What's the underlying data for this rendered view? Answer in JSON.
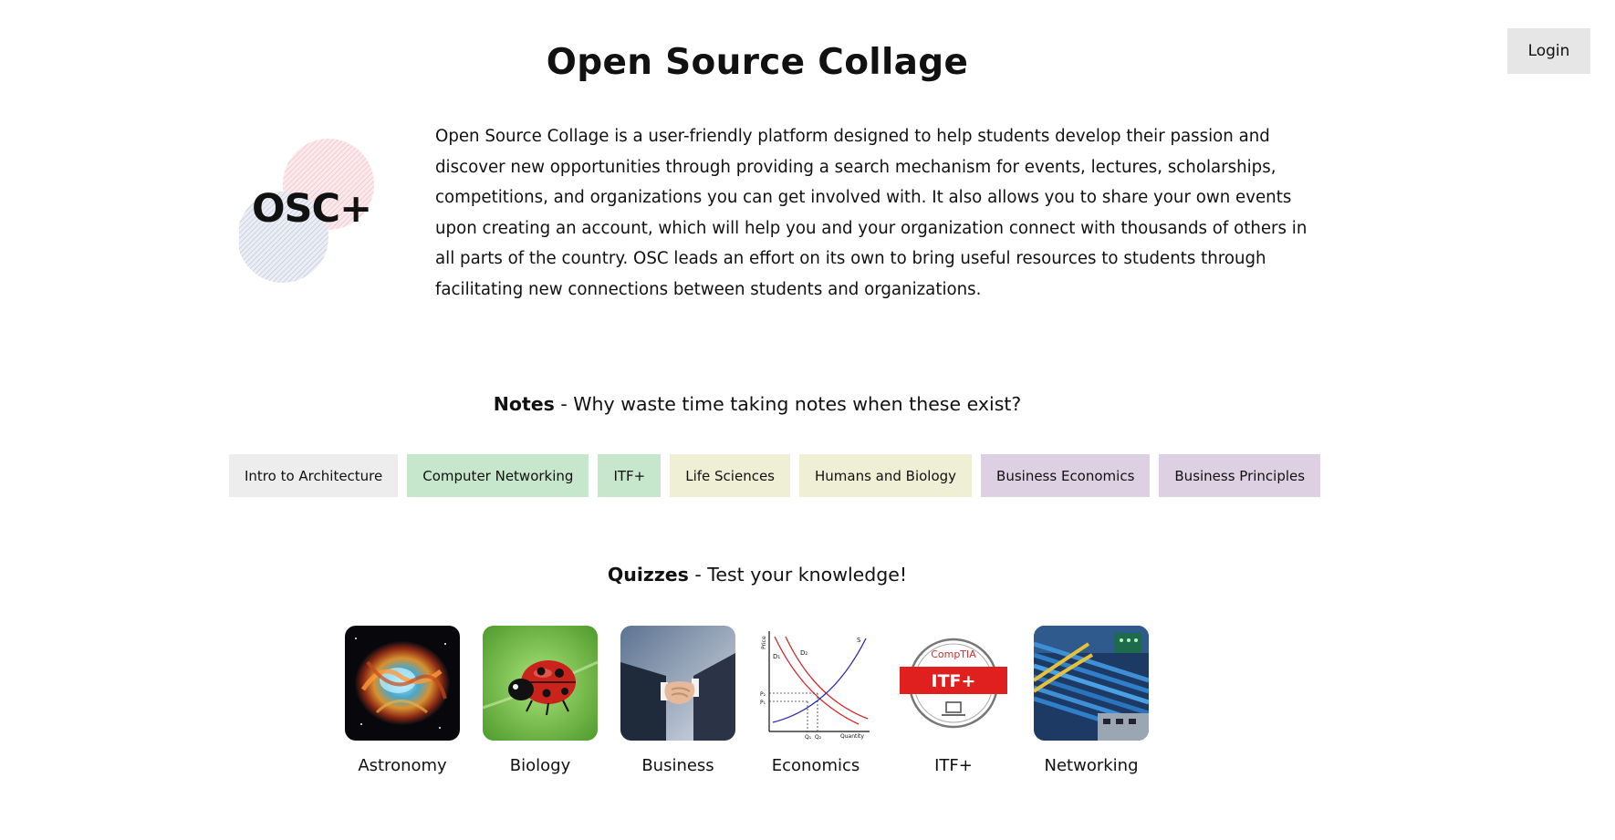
{
  "header": {
    "login_label": "Login",
    "title": "Open Source Collage"
  },
  "logo": {
    "text": "OSC+"
  },
  "intro": {
    "text": "Open Source Collage is a user-friendly platform designed to help students develop their passion and discover new opportunities through providing a search mechanism for events, lectures, scholarships, competitions, and organizations you can get involved with. It also allows you to share your own events upon creating an account, which will help you and your organization connect with thousands of others in all parts of the country. OSC leads an effort on its own to bring useful resources to students through facilitating new connections between students and organizations."
  },
  "notes": {
    "heading_bold": "Notes",
    "heading_rest": " - Why waste time taking notes when these exist?",
    "items": [
      {
        "label": "Intro to Architecture",
        "color": "#ededed"
      },
      {
        "label": "Computer Networking",
        "color": "#c6e7cb"
      },
      {
        "label": "ITF+",
        "color": "#c6e7cb"
      },
      {
        "label": "Life Sciences",
        "color": "#efefd6"
      },
      {
        "label": "Humans and Biology",
        "color": "#efefd6"
      },
      {
        "label": "Business Economics",
        "color": "#ddd0e3"
      },
      {
        "label": "Business Principles",
        "color": "#ddd0e3"
      }
    ]
  },
  "quizzes": {
    "heading_bold": "Quizzes",
    "heading_rest": " - Test your knowledge!",
    "items": [
      {
        "label": "Astronomy",
        "icon": "nebula-image"
      },
      {
        "label": "Biology",
        "icon": "ladybug-image"
      },
      {
        "label": "Business",
        "icon": "handshake-image"
      },
      {
        "label": "Economics",
        "icon": "supply-demand-chart-image"
      },
      {
        "label": "ITF+",
        "icon": "comptia-itf-badge-image"
      },
      {
        "label": "Networking",
        "icon": "network-cables-image"
      }
    ],
    "economics_chart_labels": {
      "y": "Price",
      "x": "Quantity",
      "d1": "D₁",
      "d2": "D₂",
      "s": "S",
      "p1": "P₁",
      "p2": "P₂",
      "q1": "Q₁",
      "q2": "Q₂"
    },
    "itf_badge": {
      "brand": "CompTIA",
      "name": "ITF+"
    }
  }
}
